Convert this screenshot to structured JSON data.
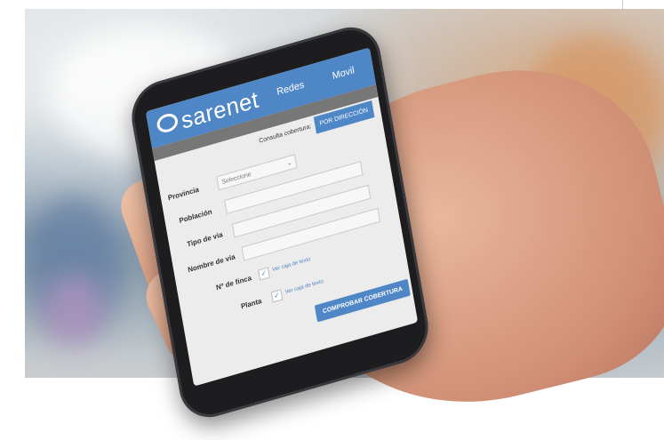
{
  "app": {
    "brand": "sarenet",
    "nav": [
      "Redes",
      "Movil"
    ]
  },
  "form": {
    "tab_label": "Consulta cobertura:",
    "tab_active": "POR DIRECCIÓN",
    "fields": {
      "provincia": {
        "label": "Provincia",
        "value": "Seleccione"
      },
      "poblacion": {
        "label": "Población",
        "value": ""
      },
      "tipo_via": {
        "label": "Tipo de via",
        "value": ""
      },
      "nombre_via": {
        "label": "Nombre de via",
        "value": ""
      },
      "finca": {
        "label": "Nº de finca",
        "checkbox": "Ver caja de texto"
      },
      "planta": {
        "label": "Planta",
        "checkbox": "Ver caja de texto"
      }
    },
    "submit_label": "COMPROBAR COBERTURA"
  },
  "colors": {
    "brand_blue": "#4e86c6",
    "subbar": "#777777"
  }
}
